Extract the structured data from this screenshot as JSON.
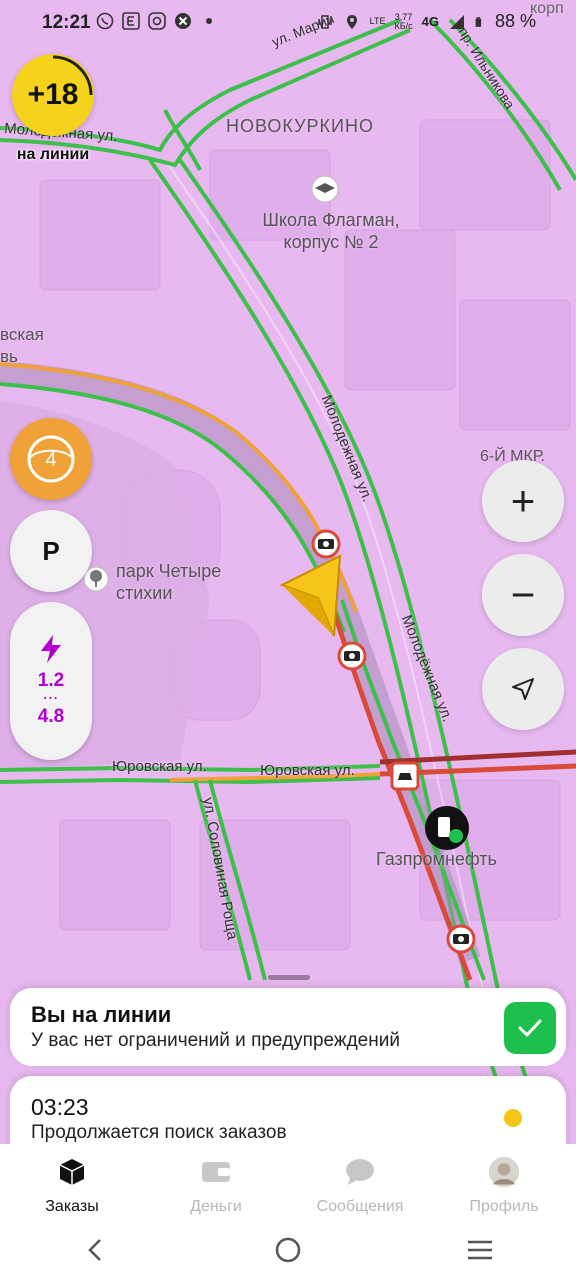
{
  "status_bar": {
    "time": "12:21",
    "left_icons": [
      "whatsapp-icon",
      "e-square-icon",
      "instagram-icon",
      "x-circle-icon",
      "dot-icon"
    ],
    "net_speed_value": "3,77",
    "net_speed_unit": "КБ/с",
    "network": "4G",
    "lte": "LTE",
    "battery": "88 %"
  },
  "rating": {
    "value": "+18",
    "label": "на линии"
  },
  "side_buttons": {
    "level": "4",
    "parking": "P",
    "surge_top": "1.2",
    "surge_dots": "⋯",
    "surge_bottom": "4.8"
  },
  "map_labels": {
    "district": "НОВОКУРКИНО",
    "school": "Школа Флагман,\nкорпус № 2",
    "street_molodezhnaya_top": "Молодежная ул.",
    "street_molodezhnaya_diag": "Молодежная ул.",
    "street_molodezhnaya_right": "Молодёжная ул.",
    "street_marii": "ул. Марии",
    "street_ilnikova": "пр. Ильникова",
    "mkr": "6-Й МКР.",
    "park": "парк Четыре\nстихии",
    "street_yurovskaya_1": "Юровская ул.",
    "street_yurovskaya_2": "Юровская ул.",
    "street_solovinaya": "ул. Соловиная Роща",
    "gas_station": "Газпромнефть",
    "partial_left": "вская\nвь",
    "partial_top_right": "корп"
  },
  "map_controls": {
    "zoom_in": "+",
    "zoom_out": "−"
  },
  "status_card": {
    "title": "Вы на линии",
    "subtitle": "У вас нет ограничений и предупреждений"
  },
  "search_card": {
    "time": "03:23",
    "subtitle": "Продолжается поиск заказов"
  },
  "tabs": [
    {
      "label": "Заказы",
      "icon": "box-icon",
      "active": true
    },
    {
      "label": "Деньги",
      "icon": "wallet-icon",
      "active": false
    },
    {
      "label": "Сообщения",
      "icon": "chat-icon",
      "active": false
    },
    {
      "label": "Профиль",
      "icon": "avatar-icon",
      "active": false
    }
  ],
  "colors": {
    "map_bg": "#e8b8f0",
    "accent_yellow": "#f5d21c",
    "traffic_green": "#3cc04a",
    "traffic_red": "#d84a3a",
    "traffic_orange": "#f0a238",
    "check_green": "#1fbf4e"
  }
}
